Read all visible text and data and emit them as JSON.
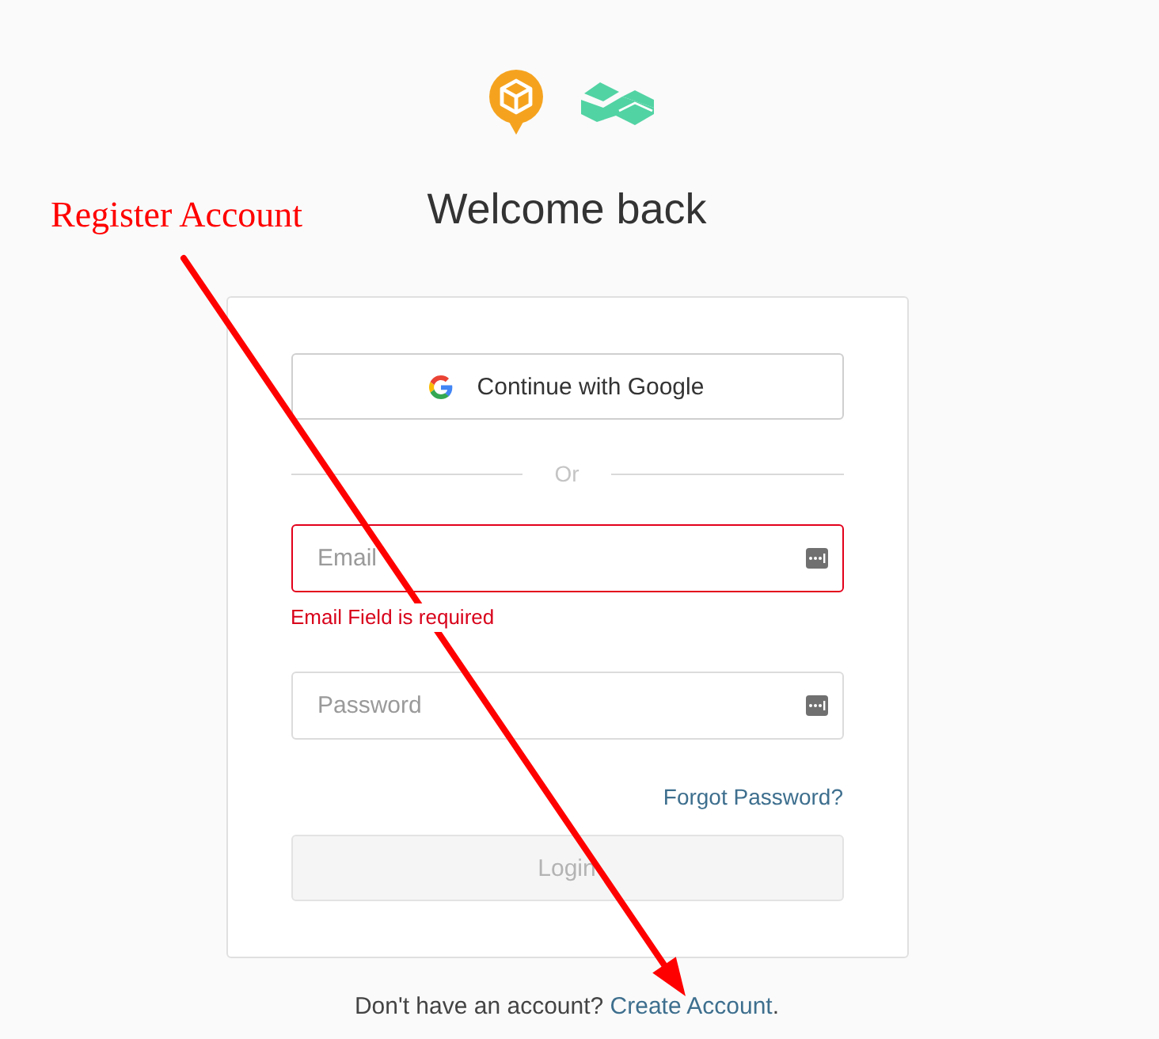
{
  "title": "Welcome back",
  "annotation": {
    "label": "Register Account"
  },
  "card": {
    "google_button": "Continue with Google",
    "divider": "Or",
    "fields": [
      {
        "placeholder": "Email",
        "invalid": true,
        "error": "Email Field is required"
      },
      {
        "placeholder": "Password",
        "invalid": false
      }
    ],
    "forgot_link": "Forgot Password?",
    "login_button": {
      "label": "Login",
      "disabled": true
    }
  },
  "footer": {
    "prefix": "Don't have an account? ",
    "link": "Create Account",
    "suffix": "."
  }
}
